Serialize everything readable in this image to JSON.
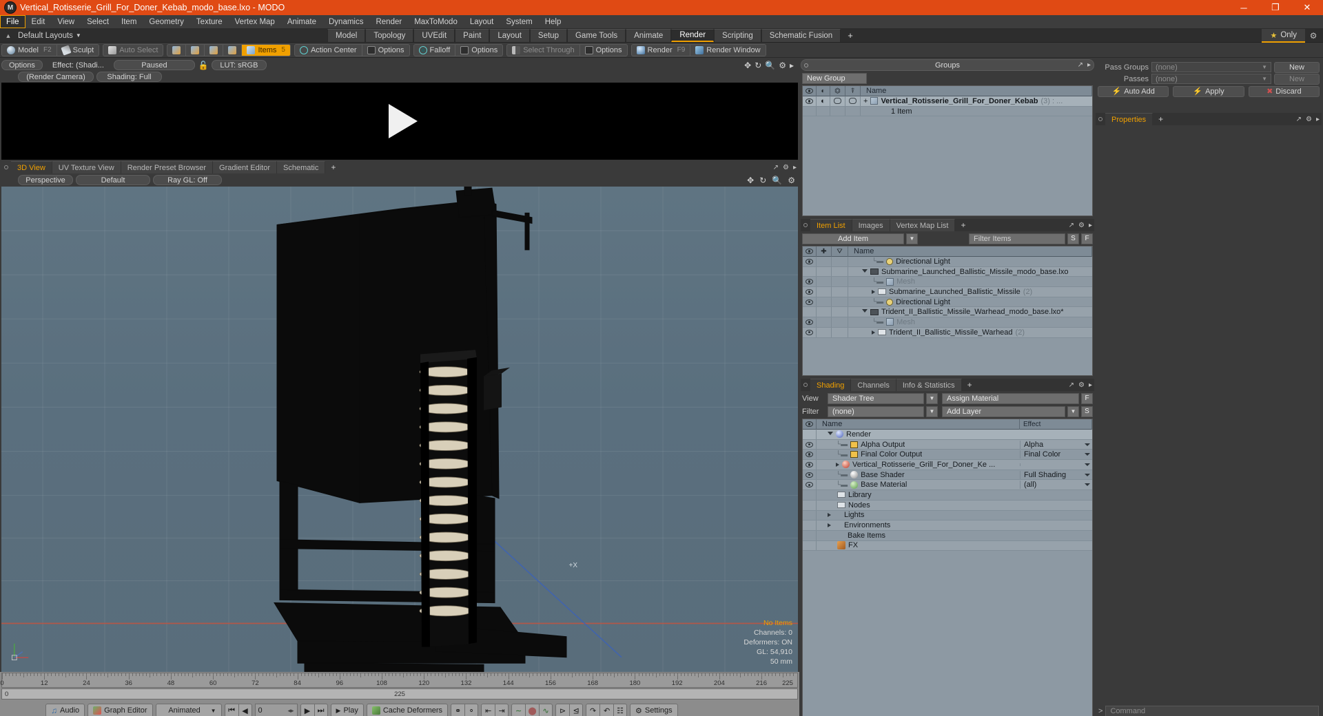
{
  "titlebar": {
    "title": "Vertical_Rotisserie_Grill_For_Doner_Kebab_modo_base.lxo - MODO",
    "app_icon": "modo-logo-icon",
    "minimize": "─",
    "maximize": "❐",
    "close": "✕"
  },
  "menubar": {
    "items": [
      "File",
      "Edit",
      "View",
      "Select",
      "Item",
      "Geometry",
      "Texture",
      "Vertex Map",
      "Animate",
      "Dynamics",
      "Render",
      "MaxToModo",
      "Layout",
      "System",
      "Help"
    ],
    "active": "File"
  },
  "layoutbar": {
    "default_layouts": "Default Layouts",
    "tabs": [
      "Model",
      "Topology",
      "UVEdit",
      "Paint",
      "Layout",
      "Setup",
      "Game Tools",
      "Animate",
      "Render",
      "Scripting",
      "Schematic Fusion"
    ],
    "selected": "Render",
    "plus": "+",
    "only_label": "Only",
    "star_icon": "star-icon",
    "gear_icon": "gear-icon"
  },
  "modebar": {
    "model": "Model",
    "model_key": "F2",
    "sculpt": "Sculpt",
    "auto_select": "Auto Select",
    "items": "Items",
    "items_key": "5",
    "action_center": "Action Center",
    "options1": "Options",
    "falloff": "Falloff",
    "options2": "Options",
    "select_through": "Select Through",
    "options3": "Options",
    "render": "Render",
    "render_key": "F9",
    "render_window": "Render Window"
  },
  "render_preview": {
    "options": "Options",
    "effect": "Effect: (Shadi...",
    "paused": "Paused",
    "lock_icon": "unlock-icon",
    "lut": "LUT: sRGB",
    "render_camera": "(Render Camera)",
    "shading": "Shading: Full",
    "play_icon": "play-triangle-icon",
    "header_icons": [
      "move-icon",
      "rotate-icon",
      "zoom-icon",
      "gear-icon",
      "menu-icon"
    ]
  },
  "viewport": {
    "tabs": [
      "3D View",
      "UV Texture View",
      "Render Preset Browser",
      "Gradient Editor",
      "Schematic"
    ],
    "selected": "3D View",
    "plus": "+",
    "perspective": "Perspective",
    "default": "Default",
    "raygl": "Ray GL: Off",
    "axis_label": "+X",
    "stats": {
      "no_items": "No Items",
      "channels": "Channels: 0",
      "deformers": "Deformers: ON",
      "gl": "GL: 54,910",
      "scale": "50 mm"
    }
  },
  "timeline": {
    "ticks": [
      0,
      12,
      24,
      36,
      48,
      60,
      72,
      84,
      96,
      108,
      120,
      132,
      144,
      156,
      168,
      180,
      192,
      204,
      216
    ],
    "range_start": "0",
    "range_center": "225",
    "range_end": "225"
  },
  "bottombar": {
    "audio": "Audio",
    "graph_editor": "Graph Editor",
    "animated": "Animated",
    "frame_value": "0",
    "play": "Play",
    "cache_deformers": "Cache Deformers",
    "settings": "Settings",
    "transport": [
      "skip-start-icon",
      "step-back-icon",
      "step-forward-icon",
      "skip-end-icon"
    ],
    "tool_icons": [
      "key-icon",
      "key-alt-icon",
      "range-start-icon",
      "range-end-icon",
      "curve-icon",
      "ellipse-icon",
      "anim-icon",
      "out-icon",
      "in-icon",
      "cycle-icon",
      "cycle-alt-icon",
      "snap-icon"
    ]
  },
  "groups_panel": {
    "title": "Groups",
    "new_group": "New Group",
    "columns": [
      "eye-icon",
      "shade-icon",
      "lock-icon",
      "select-icon",
      "Name"
    ],
    "rows": [
      {
        "name": "Vertical_Rotisserie_Grill_For_Doner_Kebab",
        "count": "(3) : ...",
        "sub": "1 Item",
        "expander": "+"
      }
    ]
  },
  "item_list": {
    "tabs": [
      "Item List",
      "Images",
      "Vertex Map List"
    ],
    "selected": "Item List",
    "plus": "+",
    "add_item": "Add Item",
    "filter_placeholder": "Filter Items",
    "btn_s": "S",
    "btn_f": "F",
    "columns": [
      "eye-icon",
      "lock-icon",
      "axis-icon",
      "Name"
    ],
    "rows": [
      {
        "name": "Directional Light",
        "icon": "light-icon",
        "indent": 2,
        "eye": true,
        "marker": "dash"
      },
      {
        "name": "Submarine_Launched_Ballistic_Missile_modo_base.lxo",
        "icon": "scene-icon",
        "indent": 1,
        "eye": false,
        "marker": "tri-down"
      },
      {
        "name": "Mesh",
        "icon": "mesh-icon",
        "indent": 2,
        "eye": true,
        "marker": "dash",
        "dim": true
      },
      {
        "name": "Submarine_Launched_Ballistic_Missile",
        "count": "(2)",
        "icon": "folder-icon",
        "indent": 2,
        "eye": true,
        "marker": "tri-right"
      },
      {
        "name": "Directional Light",
        "icon": "light-icon",
        "indent": 2,
        "eye": true,
        "marker": "dash"
      },
      {
        "name": "Trident_II_Ballistic_Missile_Warhead_modo_base.lxo*",
        "icon": "scene-icon",
        "indent": 1,
        "eye": false,
        "marker": "tri-down"
      },
      {
        "name": "Mesh",
        "icon": "mesh-icon",
        "indent": 2,
        "eye": true,
        "marker": "dash",
        "dim": true
      },
      {
        "name": "Trident_II_Ballistic_Missile_Warhead",
        "count": "(2)",
        "icon": "folder-icon",
        "indent": 2,
        "eye": true,
        "marker": "tri-right"
      }
    ]
  },
  "shading_panel": {
    "tabs": [
      "Shading",
      "Channels",
      "Info & Statistics"
    ],
    "selected": "Shading",
    "plus": "+",
    "view_label": "View",
    "view_value": "Shader Tree",
    "assign_material": "Assign Material",
    "btn_f": "F",
    "filter_label": "Filter",
    "filter_value": "(none)",
    "add_layer": "Add Layer",
    "btn_s": "S",
    "columns": [
      "eye-icon",
      "Name",
      "Effect"
    ],
    "rows": [
      {
        "name": "Render",
        "effect": "",
        "indent": 1,
        "icon": "render-sphere-icon",
        "marker": "tri-down",
        "eye": false,
        "sel": true,
        "no_caret": true
      },
      {
        "name": "Alpha Output",
        "effect": "Alpha",
        "indent": 2,
        "icon": "image-icon",
        "marker": "dash",
        "eye": true
      },
      {
        "name": "Final Color Output",
        "effect": "Final Color",
        "indent": 2,
        "icon": "image-icon",
        "marker": "dash",
        "eye": true
      },
      {
        "name": "Vertical_Rotisserie_Grill_For_Doner_Ke ...",
        "effect": "",
        "indent": 2,
        "icon": "material-red-icon",
        "marker": "tri-right",
        "eye": true
      },
      {
        "name": "Base Shader",
        "effect": "Full Shading",
        "indent": 2,
        "icon": "shader-icon",
        "marker": "dash",
        "eye": true
      },
      {
        "name": "Base Material",
        "effect": "(all)",
        "indent": 2,
        "icon": "material-green-icon",
        "marker": "dash",
        "eye": true
      },
      {
        "name": "Library",
        "effect": "",
        "indent": 1,
        "icon": "folder-icon",
        "marker": "none",
        "eye": false
      },
      {
        "name": "Nodes",
        "effect": "",
        "indent": 1,
        "icon": "folder-icon",
        "marker": "none",
        "eye": false
      },
      {
        "name": "Lights",
        "effect": "",
        "indent": 1,
        "icon": "none",
        "marker": "tri-right",
        "eye": false
      },
      {
        "name": "Environments",
        "effect": "",
        "indent": 1,
        "icon": "none",
        "marker": "tri-right",
        "eye": false
      },
      {
        "name": "Bake Items",
        "effect": "",
        "indent": 1,
        "icon": "none",
        "marker": "none",
        "eye": false
      },
      {
        "name": "FX",
        "effect": "",
        "indent": 1,
        "icon": "fx-icon",
        "marker": "none",
        "eye": false
      }
    ]
  },
  "right_panel": {
    "pass_groups_label": "Pass Groups",
    "pass_groups_value": "(none)",
    "passes_label": "Passes",
    "passes_value": "(none)",
    "new_label": "New",
    "new_label2": "New",
    "auto_add": "Auto Add",
    "apply": "Apply",
    "discard": "Discard",
    "properties_tab": "Properties",
    "plus": "+"
  },
  "commandbar": {
    "arrow": ">",
    "placeholder": "Command"
  }
}
